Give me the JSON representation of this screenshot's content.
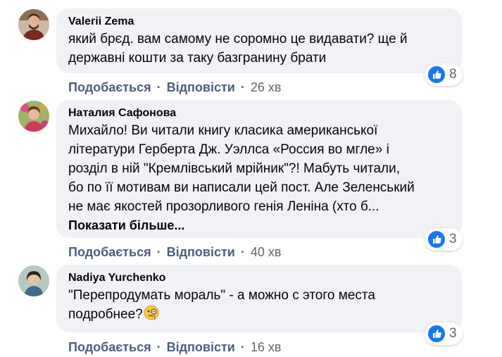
{
  "comments": [
    {
      "author": "Valerii Zema",
      "lines": [
        "який брєд. вам самому не соромно це видавати? ще й",
        "державні кошти за таку базгранину брати"
      ],
      "reaction_count": "8",
      "like_label": "Подобається",
      "reply_label": "Відповісти",
      "time": "26 хв"
    },
    {
      "author": "Наталия Сафонова",
      "lines": [
        "Михайло! Ви читали книгу класика американської",
        "літератури Герберта Дж. Уэллса «Россия во мгле» і",
        "розділ в ній \"Кремлівський мрійник\"?! Мабуть читали,",
        "бо по її мотивам ви написали цей пост. Але Зеленський",
        "не має якостей прозорливого генія Леніна (хто б..."
      ],
      "see_more": "Показати більше...",
      "reaction_count": "3",
      "like_label": "Подобається",
      "reply_label": "Відповісти",
      "time": "40 хв"
    },
    {
      "author": "Nadiya Yurchenko",
      "lines": [
        "\"Перепродумать мораль\" - а можно с этого места",
        "подробнее?"
      ],
      "emoji": "face-with-monocle",
      "reaction_count": "3",
      "like_label": "Подобається",
      "reply_label": "Відповісти",
      "time": "16 хв"
    }
  ],
  "icons": {
    "reaction": "like-thumb-icon"
  },
  "colors": {
    "bubble": "#f0f2f5",
    "like_blue": "#1877f2",
    "action_text": "#4e5d7a",
    "meta_text": "#65676b"
  }
}
